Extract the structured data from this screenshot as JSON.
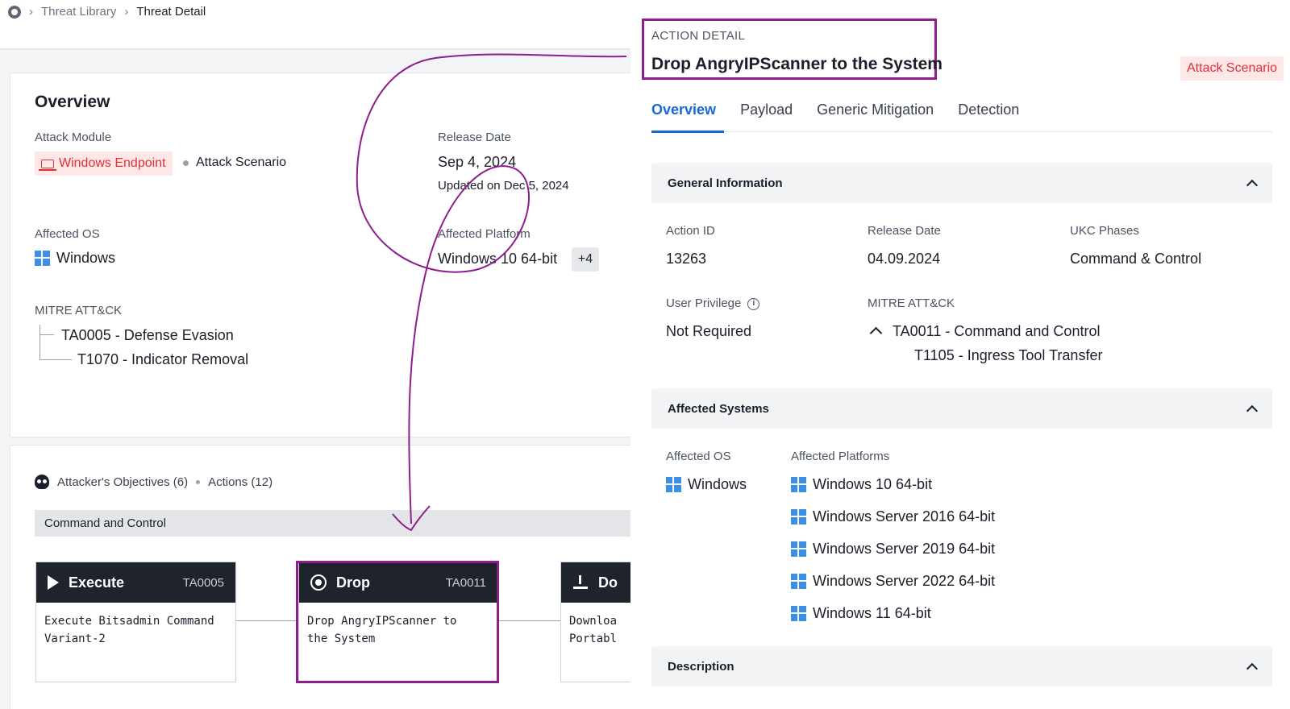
{
  "breadcrumb": {
    "items": [
      "Threat Library",
      "Threat Detail"
    ]
  },
  "overview": {
    "title": "Overview",
    "attack_module_label": "Attack Module",
    "attack_module_badge": "Windows Endpoint",
    "attack_module_type": "Attack Scenario",
    "release_date_label": "Release Date",
    "release_date": "Sep 4, 2024",
    "updated": "Updated on Dec 5, 2024",
    "affected_os_label": "Affected OS",
    "affected_os": "Windows",
    "affected_platform_label": "Affected Platform",
    "affected_platform": "Windows 10 64-bit",
    "affected_platform_more": "+4",
    "mitre_label": "MITRE ATT&CK",
    "mitre_tactic": "TA0005 - Defense Evasion",
    "mitre_technique": "T1070 - Indicator Removal"
  },
  "objectives": {
    "objectives_label": "Attacker's Objectives (6)",
    "actions_label": "Actions (12)",
    "group_title": "Command and Control",
    "cards": [
      {
        "name": "Execute",
        "code": "TA0005",
        "text_line1": "Execute Bitsadmin Command",
        "text_line2": "Variant-2",
        "icon": "play-icon"
      },
      {
        "name": "Drop",
        "code": "TA0011",
        "text_line1": "Drop AngryIPScanner to",
        "text_line2": "the System",
        "icon": "drop-icon"
      },
      {
        "name": "Do",
        "code": "",
        "text_line1": "Downloa",
        "text_line2": "Portabl",
        "icon": "download-icon"
      }
    ]
  },
  "detail": {
    "label": "ACTION DETAIL",
    "title": "Drop AngryIPScanner to the System",
    "badge": "Attack Scenario",
    "tabs": [
      "Overview",
      "Payload",
      "Generic Mitigation",
      "Detection"
    ],
    "general": {
      "title": "General Information",
      "action_id_label": "Action ID",
      "action_id": "13263",
      "release_date_label": "Release Date",
      "release_date": "04.09.2024",
      "ukc_label": "UKC Phases",
      "ukc_value": "Command & Control",
      "privilege_label": "User Privilege",
      "privilege_value": "Not Required",
      "mitre_label": "MITRE ATT&CK",
      "mitre_tactic": "TA0011 - Command and Control",
      "mitre_technique": "T1105 - Ingress Tool Transfer"
    },
    "affected": {
      "title": "Affected Systems",
      "os_label": "Affected OS",
      "os_value": "Windows",
      "platforms_label": "Affected Platforms",
      "platforms": [
        "Windows 10 64-bit",
        "Windows Server 2016 64-bit",
        "Windows Server 2019 64-bit",
        "Windows Server 2022 64-bit",
        "Windows 11 64-bit"
      ]
    },
    "description": {
      "title": "Description"
    }
  },
  "colors": {
    "accent_blue": "#1869d6",
    "badge_red": "#e0303a",
    "annotation_purple": "#8e1d8f",
    "windows_blue": "#3b8fe6",
    "card_header": "#1f232b"
  }
}
